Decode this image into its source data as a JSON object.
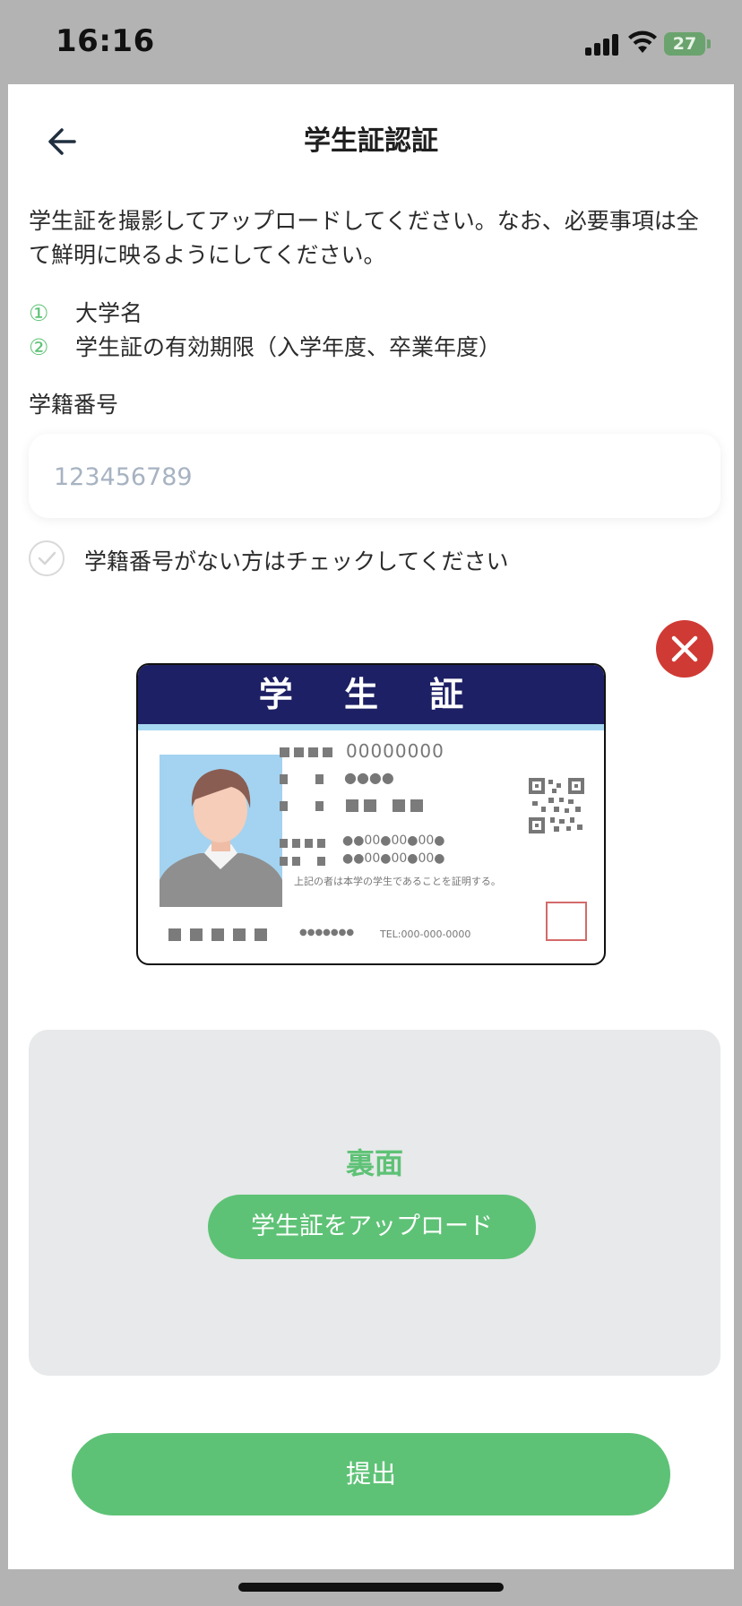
{
  "status_bar": {
    "time": "16:16",
    "battery": "27",
    "signal_icon": "cellular-signal-icon",
    "wifi_icon": "wifi-icon",
    "battery_icon": "battery-charging-icon"
  },
  "header": {
    "back_icon": "arrow-left-icon",
    "title": "学生証認証"
  },
  "instructions": {
    "text": "学生証を撮影してアップロードしてください。なお、必要事項は全て鮮明に映るようにしてください。",
    "requirements": [
      {
        "num": "①",
        "label": "大学名"
      },
      {
        "num": "②",
        "label": "学生証の有効期限（入学年度、卒業年度）"
      }
    ]
  },
  "student_id_field": {
    "label": "学籍番号",
    "placeholder": "123456789",
    "value": ""
  },
  "no_id_checkbox": {
    "label": "学籍番号がない方はチェックしてください",
    "checked": false
  },
  "front_image": {
    "remove_icon": "close-icon",
    "card": {
      "header": "学 生 証",
      "number": "00000000",
      "certify_text": "上記の者は本学の学生であることを証明する。",
      "tel": "TEL:000-000-0000",
      "footer_dots": "●●●●●●●",
      "row_dots_1": "●●00●00●00●",
      "row_dots_2": "●●00●00●00●",
      "small_dots": "●●●●"
    }
  },
  "back_upload": {
    "title": "裏面",
    "button_label": "学生証をアップロード"
  },
  "submit": {
    "label": "提出"
  },
  "colors": {
    "accent": "#5ec276",
    "danger": "#d03a34",
    "card_header": "#1d2064",
    "panel": "#e7e9ea"
  }
}
